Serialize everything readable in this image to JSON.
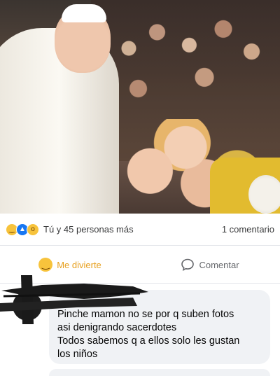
{
  "post": {
    "reactions": {
      "icons": [
        "haha-reaction-icon",
        "like-reaction-icon",
        "wow-reaction-icon"
      ],
      "summary": "Tú y 45 personas más"
    },
    "comment_count": "1 comentario"
  },
  "actions": {
    "reaction_label": "Me divierte",
    "comment_label": "Comentar"
  },
  "comment": {
    "author": "",
    "lines": [
      "Pinche mamon no se por q suben fotos",
      "asi denigrando sacerdotes",
      "Todos sabemos q a ellos solo les gustan",
      "los niños"
    ]
  },
  "colors": {
    "accent_reaction": "#e7a01f",
    "like_blue": "#1877f2",
    "comment_bubble": "#f0f2f5"
  }
}
